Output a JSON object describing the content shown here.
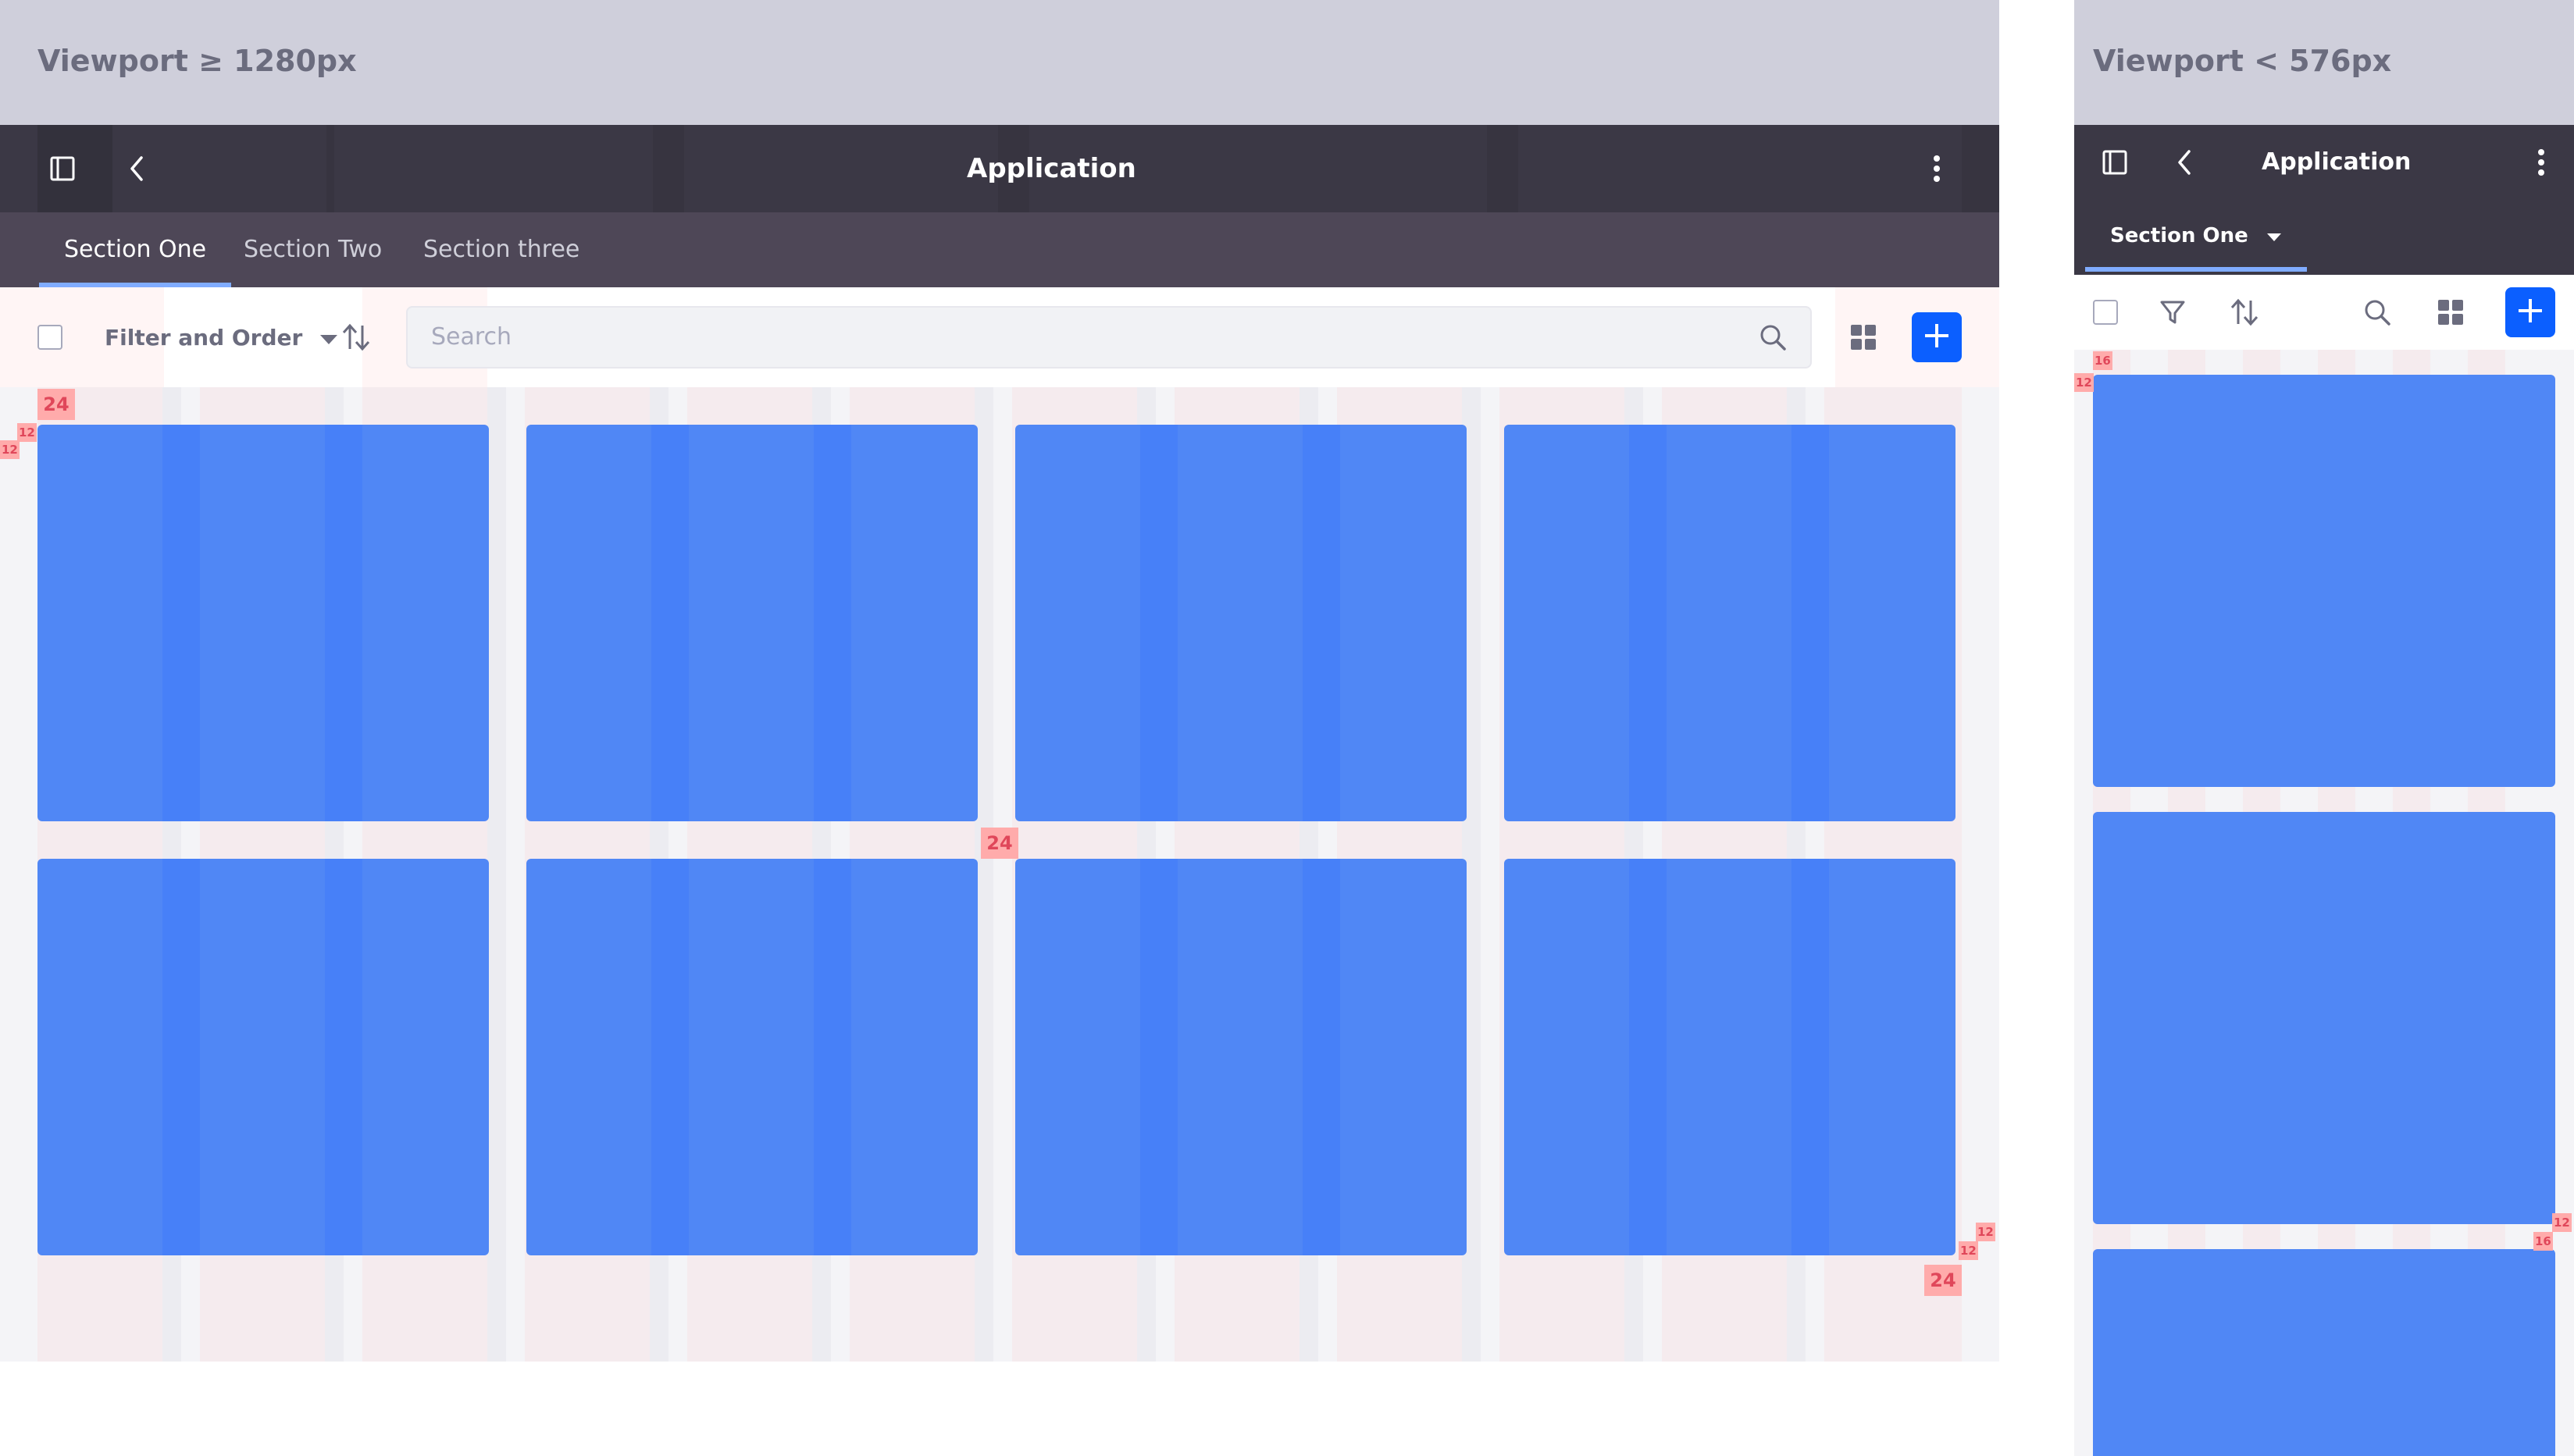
{
  "desktop": {
    "viewport_label": "Viewport ≥ 1280px",
    "app_title": "Application",
    "tabs": [
      {
        "label": "Section One",
        "active": true
      },
      {
        "label": "Section Two",
        "active": false
      },
      {
        "label": "Section three",
        "active": false
      }
    ],
    "toolbar": {
      "filter_label": "Filter and Order",
      "search_placeholder": "Search"
    },
    "spacing_annotations": [
      "24",
      "12",
      "24",
      "12",
      "12",
      "24"
    ]
  },
  "mobile": {
    "viewport_label": "Viewport  < 576px",
    "app_title": "Application",
    "active_section": "Section One",
    "spacing_annotations": [
      "16",
      "12",
      "12",
      "16"
    ]
  },
  "icons": {
    "sidebar_toggle": "sidebar-panel-icon",
    "back": "chevron-left-icon",
    "more": "kebab-vertical-icon",
    "caret": "caret-down-icon",
    "sort": "sort-arrows-icon",
    "search": "search-icon",
    "grid_view": "grid-view-icon",
    "add": "plus-icon",
    "filter": "funnel-icon"
  },
  "colors": {
    "header_bg": "#3b3845",
    "nav_bg": "#4e4757",
    "active_tab_indicator": "#80acff",
    "primary_button": "#0b5fff",
    "card": "#5087f5",
    "label_bar": "#cfcfdb",
    "spacing_badge": "#ffabab"
  }
}
